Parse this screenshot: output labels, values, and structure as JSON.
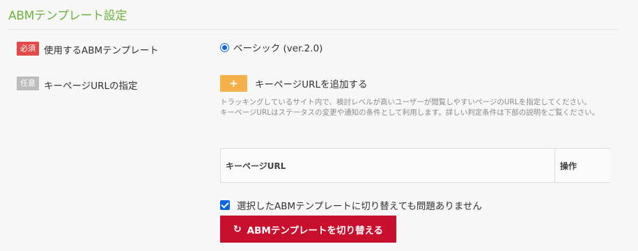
{
  "section": {
    "title": "ABMテンプレート設定"
  },
  "rows": {
    "template": {
      "badge": "必須",
      "label": "使用するABMテンプレート",
      "radio_label": "ベーシック (ver.2.0)"
    },
    "key_url": {
      "badge": "任意",
      "label": "キーページURLの指定",
      "add_symbol": "+",
      "add_label": "キーページURLを追加する",
      "help_line1": "トラッキングしているサイト内で、検討レベルが高いユーザーが閲覧しやすいページのURLを指定してください。",
      "help_line2": "キーページURLはステータスの変更や通知の条件として利用します。詳しい判定条件は下部の説明をご覧ください。",
      "table_headers": [
        "キーページURL",
        "操作"
      ]
    }
  },
  "confirm": {
    "checkbox_label": "選択したABMテンプレートに切り替えても問題ありません",
    "checked": true
  },
  "switch_button": {
    "icon": "refresh-icon",
    "label": "ABMテンプレートを切り替える"
  },
  "colors": {
    "title_green": "#6bb33c",
    "required_red": "#e34a4a",
    "optional_gray": "#bdbdbd",
    "add_orange": "#f6b04a",
    "primary_red": "#c8102e",
    "radio_blue": "#0b65e0"
  }
}
